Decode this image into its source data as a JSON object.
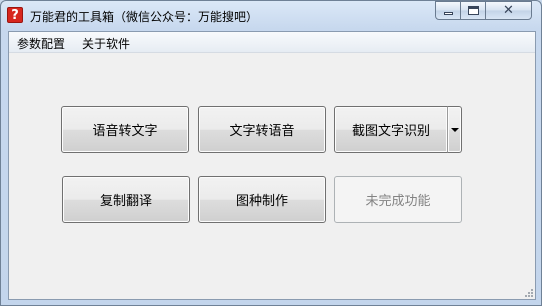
{
  "window": {
    "title": "万能君的工具箱（微信公众号：万能搜吧）",
    "icon": "question-mark-icon",
    "icon_glyph": "?",
    "icon_color": "#d7261e"
  },
  "menu": {
    "items": [
      {
        "label": "参数配置"
      },
      {
        "label": "关于软件"
      }
    ]
  },
  "buttons": {
    "speech_to_text": "语音转文字",
    "text_to_speech": "文字转语音",
    "screenshot_ocr": "截图文字识别",
    "copy_translate": "复制翻译",
    "image_seed": "图种制作",
    "unfinished": "未完成功能"
  },
  "states": {
    "unfinished_enabled": false
  }
}
